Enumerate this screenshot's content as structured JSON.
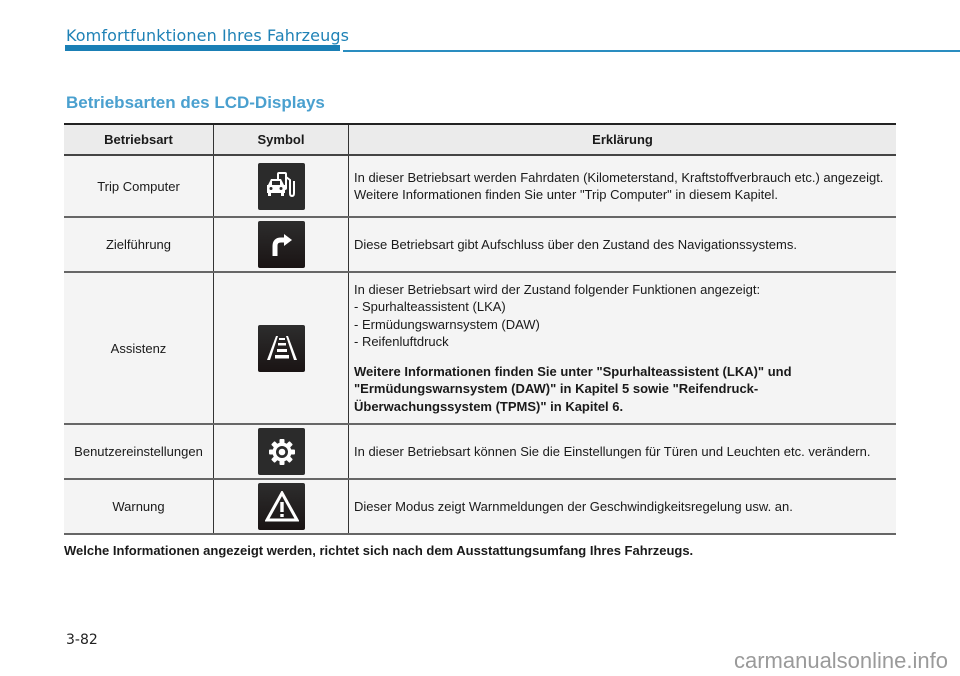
{
  "header": {
    "chapter_title": "Komfortfunktionen Ihres Fahrzeugs",
    "accent_color": "#1a7fb5"
  },
  "section": {
    "title": "Betriebsarten des LCD-Displays",
    "title_color": "#4aa0cf"
  },
  "table": {
    "columns": [
      "Betriebsart",
      "Symbol",
      "Erklärung"
    ],
    "rows": [
      {
        "mode": "Trip Computer",
        "icon": "car-fuel-pump-icon",
        "description": [
          "In dieser Betriebsart werden Fahrdaten (Kilometerstand, Kraftstoffverbrauch etc.) angezeigt.",
          "Weitere Informationen finden Sie unter \"Trip Computer\" in diesem Kapitel."
        ]
      },
      {
        "mode": "Zielführung",
        "icon": "turn-right-arrow-icon",
        "description": [
          "Diese Betriebsart gibt Aufschluss über den Zustand des Navigationssystems."
        ]
      },
      {
        "mode": "Assistenz",
        "icon": "lane-assist-icon",
        "description": [
          "In dieser Betriebsart wird der Zustand folgender Funktionen angezeigt:",
          "- Spurhalteassistent (LKA)",
          "- Ermüdungswarnsystem (DAW)",
          "- Reifenluftdruck"
        ],
        "description_bold": "Weitere Informationen finden Sie unter \"Spurhalteassistent (LKA)\" und \"Ermüdungswarnsystem (DAW)\" in Kapitel 5 sowie \"Reifendruck-Überwachungssystem (TPMS)\" in Kapitel 6."
      },
      {
        "mode": "Benutzereinstellungen",
        "icon": "gear-icon",
        "description": [
          "In dieser Betriebsart können Sie die Einstellungen für Türen und Leuchten etc. verändern."
        ]
      },
      {
        "mode": "Warnung",
        "icon": "warning-triangle-icon",
        "description": [
          "Dieser Modus zeigt Warnmeldungen der Geschwindigkeitsregelung usw. an."
        ]
      }
    ]
  },
  "footnote": "Welche Informationen angezeigt werden, richtet sich nach dem Ausstattungsumfang Ihres Fahrzeugs.",
  "page_number": "3-82",
  "watermark": "carmanualsonline.info"
}
